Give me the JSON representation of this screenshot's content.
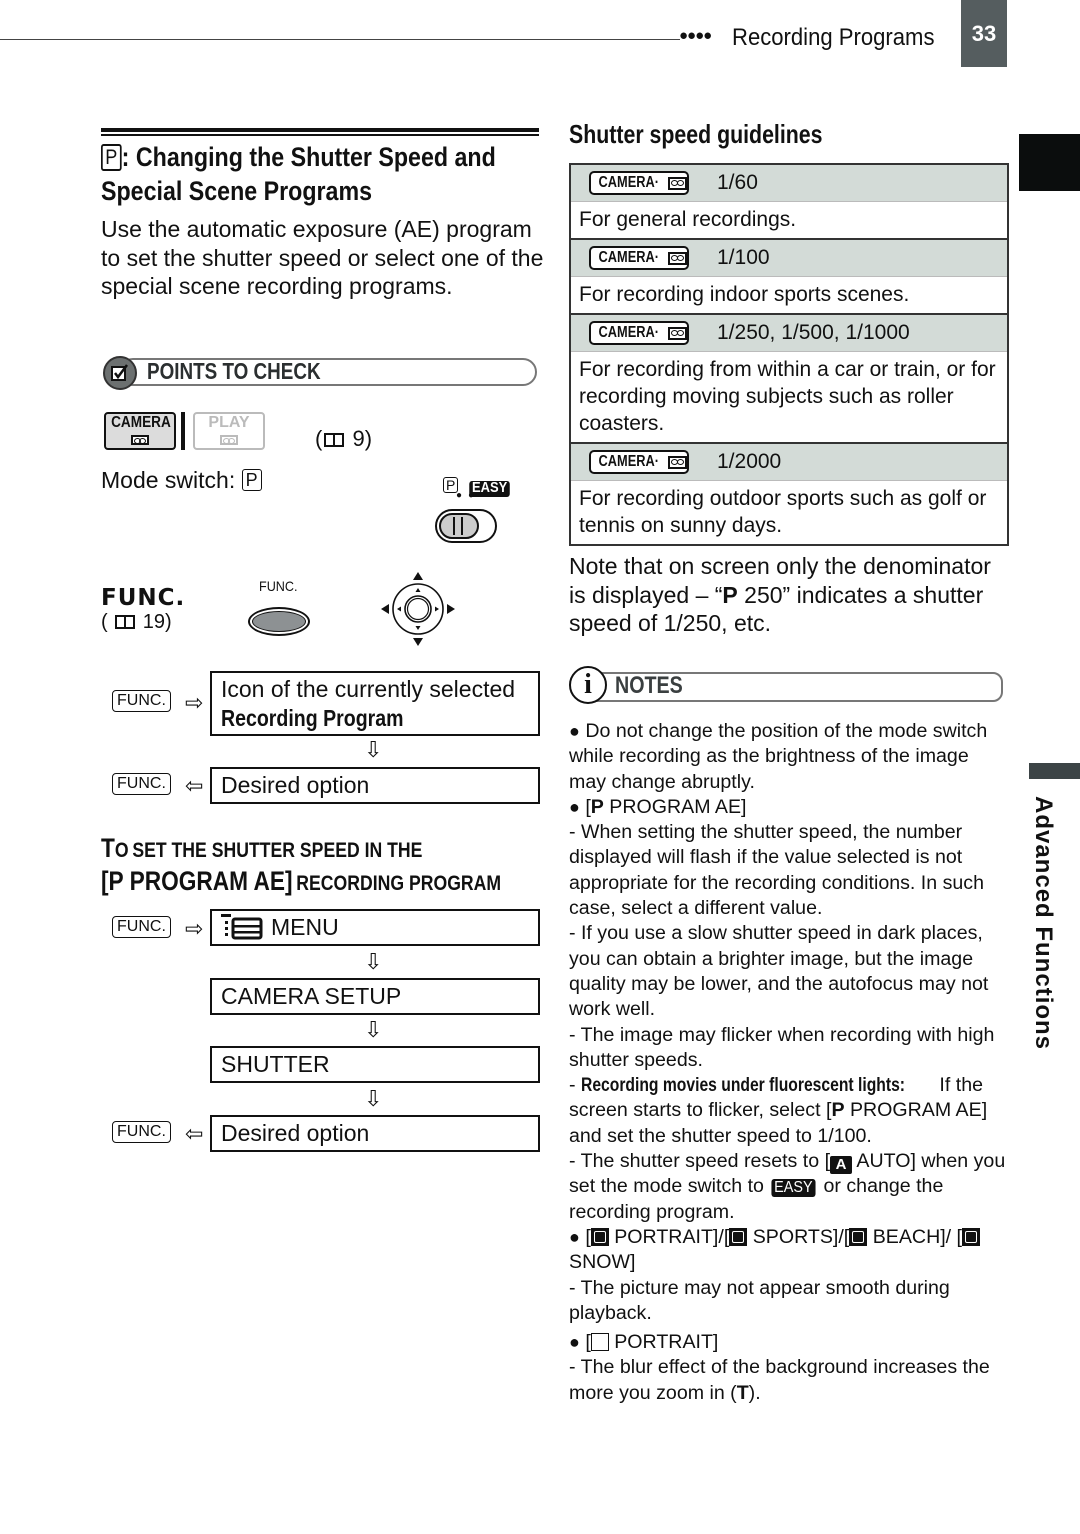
{
  "header": {
    "dots": "●●●●",
    "section_title": "Recording Programs",
    "page_number": "33"
  },
  "side_tab": {
    "label": "Advanced Functions"
  },
  "left": {
    "title_prefix": "P",
    "title": ": Changing the Shutter Speed and Special Scene Programs",
    "intro": "Use the automatic exposure (AE) program to set the shutter speed or select one of the special scene recording programs.",
    "points_to_check": {
      "label": "POINTS TO CHECK",
      "camera_button": "CAMERA",
      "play_button": "PLAY",
      "page_ref_open": "(",
      "page_ref": "9)",
      "mode_switch_label": "Mode switch:",
      "mode_switch_value": "P",
      "switch_positions": [
        "P",
        "EASY"
      ]
    },
    "func": {
      "label": "FUNC.",
      "page_ref_open": "(",
      "page_ref": "19)",
      "button_label": "FUNC."
    },
    "flow1": {
      "key1": "FUNC.",
      "box1_line1": "Icon of the currently selected",
      "box1_line2": "Recording Program",
      "key2": "FUNC.",
      "box2": "Desired option",
      "arrow_right": "⇨",
      "arrow_left": "⇦",
      "arrow_down": "⇩"
    },
    "subheading": {
      "line1_big": "T",
      "line1_rest_big": "O",
      "line1_small": "SET THE SHUTTER SPEED IN THE",
      "line2_big": "[P PROGRAM AE]",
      "line2_small": "RECORDING PROGRAM"
    },
    "flow2": {
      "key1": "FUNC.",
      "step1": "MENU",
      "step2": "CAMERA SETUP",
      "step3": "SHUTTER",
      "key2": "FUNC.",
      "step4": "Desired option"
    }
  },
  "right": {
    "guidelines_title": "Shutter speed guidelines",
    "camera_badge": "CAMERA·",
    "table": [
      {
        "speed": "1/60",
        "description": "For general recordings."
      },
      {
        "speed": "1/100",
        "description": "For recording indoor sports scenes."
      },
      {
        "speed": "1/250, 1/500, 1/1000",
        "description": "For recording from within a car or train, or for recording moving subjects such as roller coasters."
      },
      {
        "speed": "1/2000",
        "description": "For recording outdoor sports such as golf or tennis on sunny days."
      }
    ],
    "note_part1": "Note that on screen only the denominator is displayed – “",
    "note_p": "P",
    "note_part2": " 250” indicates a shutter speed of 1/250, etc.",
    "notes_label": "NOTES",
    "notes": {
      "b1": "Do not change the position of the mode switch while recording as the brightness of the image may change abruptly.",
      "b2_open": "[",
      "b2_p": "P",
      "b2_rest": "  PROGRAM AE]",
      "d1": "-  When setting the shutter speed, the number displayed will flash if the value selected is not appropriate for the recording conditions. In such case, select a different value.",
      "d2": "-  If you use a slow shutter speed in dark places, you can obtain a brighter image, but the image quality may be lower, and the autofocus may not work well.",
      "d3": "-  The image may flicker when recording with high shutter speeds.",
      "d4_dash": "-  ",
      "d4_bold": "Recording movies under fluorescent lights:",
      "d4_a": " If the screen starts to flicker, select [",
      "d4_p": "P",
      "d4_b": "  PROGRAM AE] and set the shutter speed to 1/100.",
      "d5_a": "-  The shutter speed resets to [",
      "d5_icon": "A",
      "d5_b": "  AUTO] when you set the mode switch to ",
      "d5_easy": "EASY",
      "d5_c": " or change the recording program.",
      "b3_a": "[",
      "b3_portrait": " PORTRAIT]/[",
      "b3_sports": " SPORTS]/[",
      "b3_beach": " BEACH]/ [",
      "b3_snow": " SNOW]",
      "d6": "-  The picture may not appear smooth during playback.",
      "b4_a": "[",
      "b4_portrait": "  PORTRAIT]",
      "d7_a": "-  The blur effect of the background increases the more you zoom in (",
      "d7_t": "T",
      "d7_b": ")."
    }
  }
}
